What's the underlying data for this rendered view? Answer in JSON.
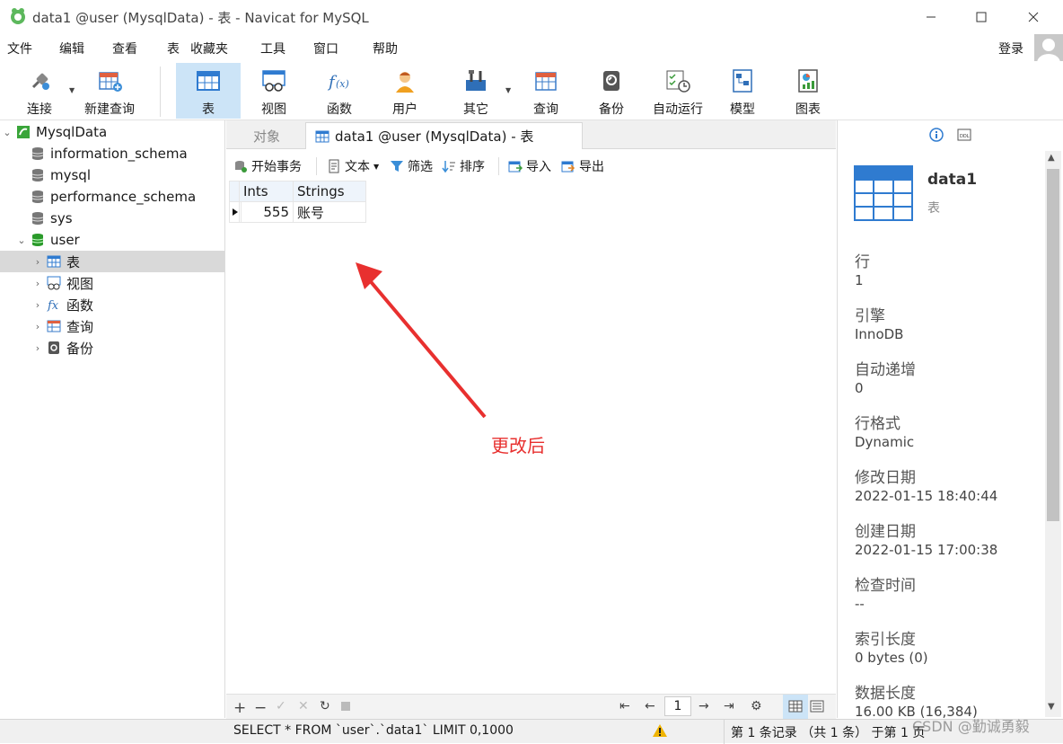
{
  "window": {
    "title": "data1 @user (MysqlData) - 表 - Navicat for MySQL"
  },
  "menu": [
    "文件",
    "编辑",
    "查看",
    "表",
    "收藏夹",
    "工具",
    "窗口",
    "帮助"
  ],
  "account": {
    "login_label": "登录"
  },
  "toolbar": {
    "buttons": [
      {
        "label": "连接",
        "icon": "plug-icon"
      },
      {
        "label": "新建查询",
        "icon": "new-query-icon"
      },
      {
        "label": "表",
        "icon": "table-icon",
        "active": true
      },
      {
        "label": "视图",
        "icon": "view-icon"
      },
      {
        "label": "函数",
        "icon": "function-icon"
      },
      {
        "label": "用户",
        "icon": "user-icon"
      },
      {
        "label": "其它",
        "icon": "tools-icon"
      },
      {
        "label": "查询",
        "icon": "query-icon"
      },
      {
        "label": "备份",
        "icon": "backup-icon"
      },
      {
        "label": "自动运行",
        "icon": "schedule-icon"
      },
      {
        "label": "模型",
        "icon": "model-icon"
      },
      {
        "label": "图表",
        "icon": "chart-icon"
      }
    ]
  },
  "sidebar": {
    "connection": "MysqlData",
    "databases": [
      "information_schema",
      "mysql",
      "performance_schema",
      "sys",
      "user"
    ],
    "user_children": [
      "表",
      "视图",
      "函数",
      "查询",
      "备份"
    ]
  },
  "tabs": {
    "objects_label": "对象",
    "active_label": "data1 @user (MysqlData) - 表"
  },
  "data_toolbar": {
    "begin_transaction": "开始事务",
    "text": "文本",
    "filter": "筛选",
    "sort": "排序",
    "import": "导入",
    "export": "导出"
  },
  "grid": {
    "columns": [
      "Ints",
      "Strings"
    ],
    "rows": [
      [
        "555",
        "账号"
      ]
    ]
  },
  "annotation": {
    "text": "更改后",
    "color": "#e8302f"
  },
  "pager": {
    "page": "1"
  },
  "info_panel": {
    "name": "data1",
    "type": "表",
    "props": [
      {
        "label": "行",
        "value": "1"
      },
      {
        "label": "引擎",
        "value": "InnoDB"
      },
      {
        "label": "自动递增",
        "value": "0"
      },
      {
        "label": "行格式",
        "value": "Dynamic"
      },
      {
        "label": "修改日期",
        "value": "2022-01-15 18:40:44"
      },
      {
        "label": "创建日期",
        "value": "2022-01-15 17:00:38"
      },
      {
        "label": "检查时间",
        "value": "--"
      },
      {
        "label": "索引长度",
        "value": "0 bytes (0)"
      },
      {
        "label": "数据长度",
        "value": "16.00 KB (16,384)"
      }
    ]
  },
  "status": {
    "sql": "SELECT * FROM `user`.`data1` LIMIT 0,1000",
    "records": "第 1 条记录 （共 1 条） 于第 1 页",
    "watermark": "CSDN @勤诚勇毅"
  },
  "colors": {
    "accent": "#cce4f7",
    "grid_header": "#eef4fb",
    "annotation": "#e8302f"
  }
}
